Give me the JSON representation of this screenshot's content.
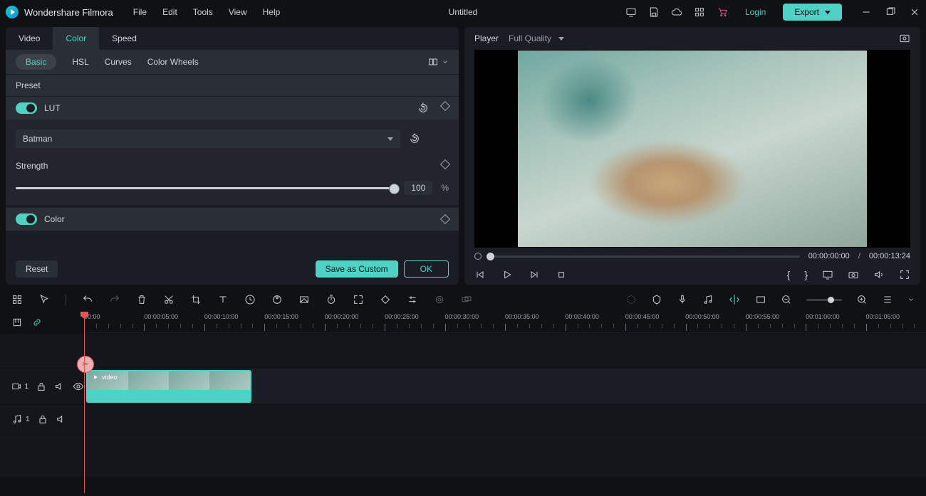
{
  "brand": "Wondershare Filmora",
  "menu": [
    "File",
    "Edit",
    "Tools",
    "View",
    "Help"
  ],
  "title": "Untitled",
  "login": "Login",
  "export": "Export",
  "tabs": [
    "Video",
    "Color",
    "Speed"
  ],
  "activeTab": 1,
  "subtabs": [
    "Basic",
    "HSL",
    "Curves",
    "Color Wheels"
  ],
  "preset_label": "Preset",
  "lut": {
    "label": "LUT",
    "selected": "Batman",
    "strength_label": "Strength",
    "strength_value": "100",
    "pct": "%"
  },
  "color_section": "Color",
  "buttons": {
    "reset": "Reset",
    "save_custom": "Save as Custom",
    "ok": "OK"
  },
  "player": {
    "label": "Player",
    "quality": "Full Quality",
    "current": "00:00:00:00",
    "sep": "/",
    "total": "00:00:13:24"
  },
  "ruler": [
    "00:00",
    "00:00:05:00",
    "00:00:10:00",
    "00:00:15:00",
    "00:00:20:00",
    "00:00:25:00",
    "00:00:30:00",
    "00:00:35:00",
    "00:00:40:00",
    "00:00:45:00",
    "00:00:50:00",
    "00:00:55:00",
    "00:01:00:00",
    "00:01:05:00"
  ],
  "track_video_index": "1",
  "track_audio_index": "1",
  "clip_name": "video"
}
